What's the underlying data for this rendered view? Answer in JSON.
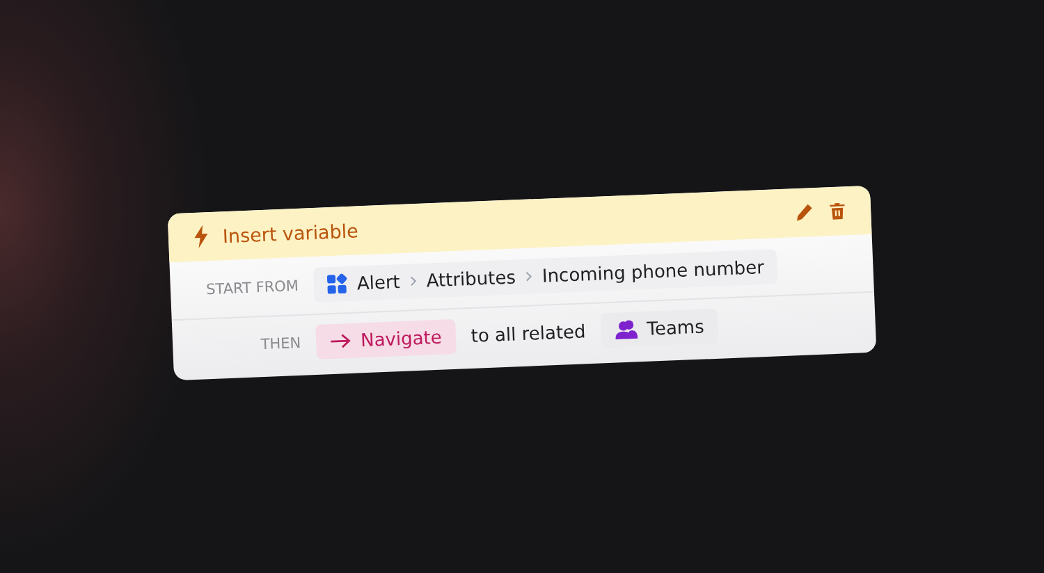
{
  "header": {
    "title": "Insert variable"
  },
  "rows": [
    {
      "label": "START FROM",
      "items": [
        {
          "kind": "path",
          "segments": [
            "Alert",
            "Attributes",
            "Incoming phone number"
          ]
        }
      ]
    },
    {
      "label": "THEN",
      "items": [
        {
          "kind": "action",
          "text": "Navigate"
        },
        {
          "kind": "text",
          "text": "to all related"
        },
        {
          "kind": "entity",
          "text": "Teams"
        }
      ]
    }
  ]
}
